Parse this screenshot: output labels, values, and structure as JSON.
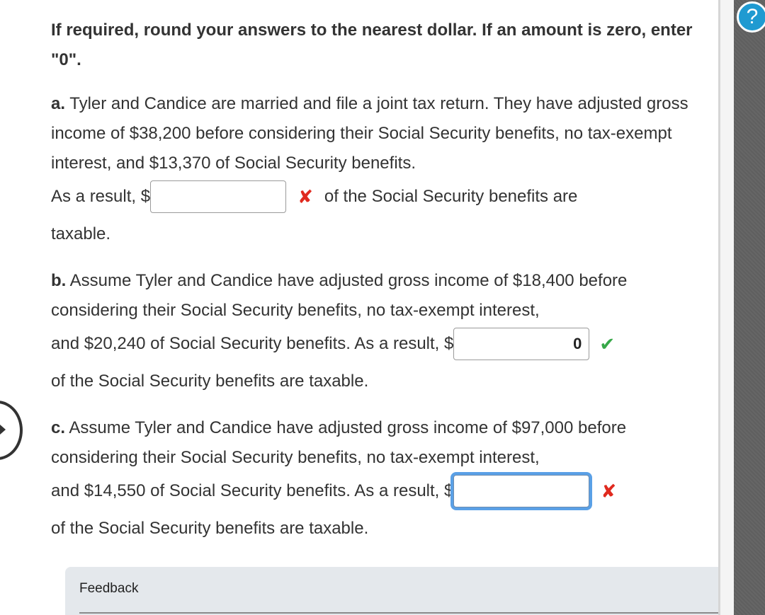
{
  "instructions": "If required, round your answers to the nearest dollar. If an amount is zero, enter \"0\".",
  "questions": [
    {
      "letter": "a.",
      "text": "Tyler and Candice are married and file a joint tax return. They have adjusted gross income of $38,200 before considering their Social Security benefits, no tax-exempt interest, and $13,370 of Social Security benefits.",
      "prefix": "As a result, $",
      "value": "",
      "suffix": "of the Social Security benefits are",
      "trailing": "taxable.",
      "status": "incorrect",
      "status_icon": "x-icon"
    },
    {
      "letter": "b.",
      "text": "Assume Tyler and Candice have adjusted gross income of $18,400 before considering their Social Security benefits, no tax-exempt interest,",
      "prefix": "and $20,240 of Social Security benefits. As a result, $",
      "value": "0",
      "trailing": "of the Social Security benefits are taxable.",
      "status": "correct",
      "status_icon": "check-icon"
    },
    {
      "letter": "c.",
      "text": "Assume Tyler and Candice have adjusted gross income of $97,000 before considering their Social Security benefits, no tax-exempt interest,",
      "prefix": "and $14,550 of Social Security benefits. As a result, $",
      "value": "",
      "trailing": "of the Social Security benefits are taxable.",
      "status": "incorrect",
      "status_icon": "x-icon"
    }
  ],
  "marks": {
    "x": "✘",
    "check": "✔"
  },
  "feedback": {
    "label": "Feedback"
  },
  "help": {
    "icon": "?"
  },
  "colors": {
    "incorrect": "#e02a1f",
    "correct": "#37a849",
    "focus_ring": "#5aa0e6",
    "help_button": "#1f9ad1",
    "feedback_bg": "#e4e8ec"
  }
}
